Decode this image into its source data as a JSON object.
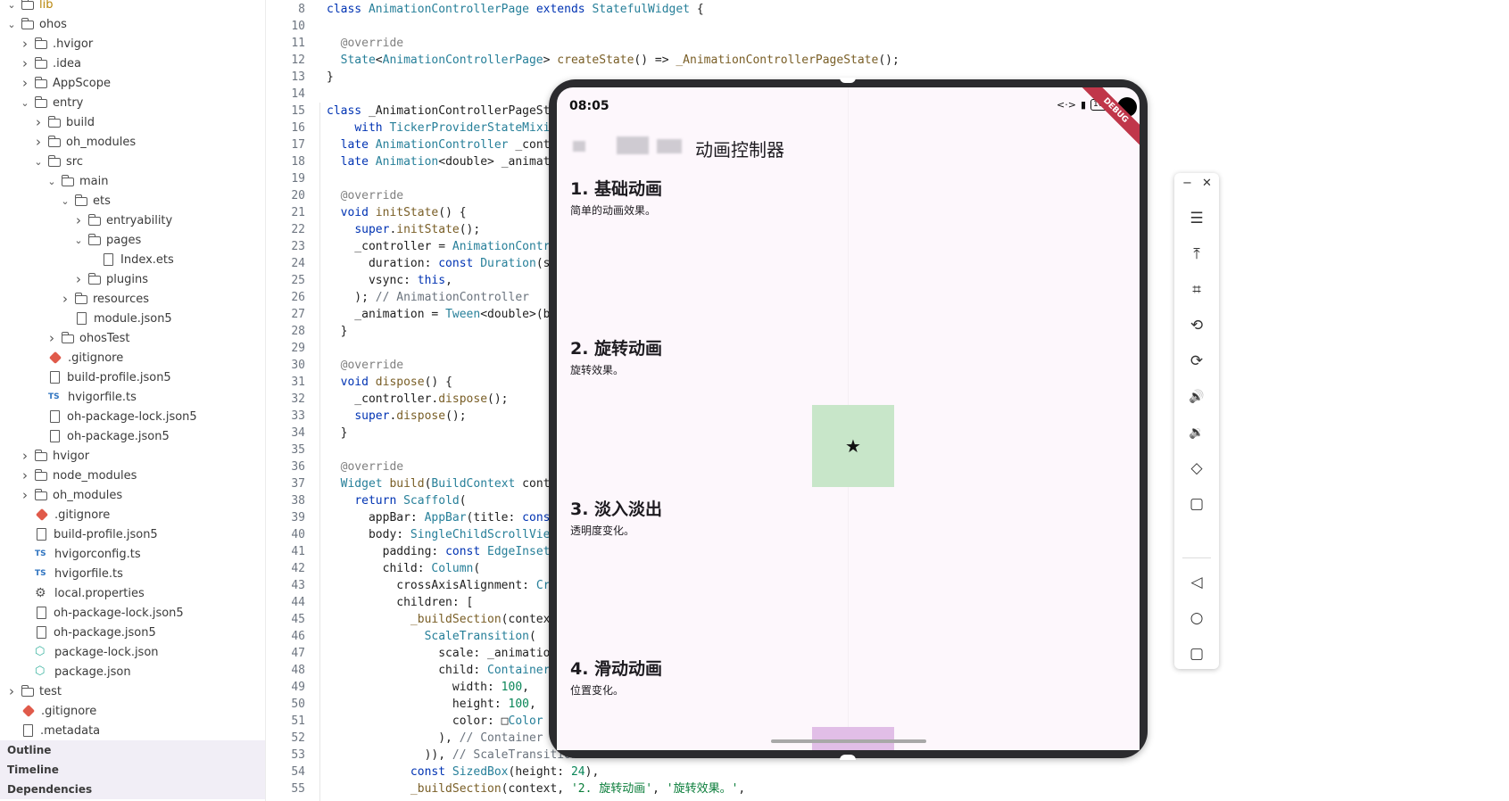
{
  "explorer": {
    "items": [
      {
        "label": "lib",
        "depth": 0,
        "kind": "folder",
        "chev": "expanded"
      },
      {
        "label": "ohos",
        "depth": 0,
        "kind": "folder",
        "chev": "expanded"
      },
      {
        "label": ".hvigor",
        "depth": 1,
        "kind": "folder",
        "chev": "collapsed"
      },
      {
        "label": ".idea",
        "depth": 1,
        "kind": "folder",
        "chev": "collapsed"
      },
      {
        "label": "AppScope",
        "depth": 1,
        "kind": "folder",
        "chev": "collapsed"
      },
      {
        "label": "entry",
        "depth": 1,
        "kind": "folder",
        "chev": "expanded"
      },
      {
        "label": "build",
        "depth": 2,
        "kind": "folder",
        "chev": "collapsed"
      },
      {
        "label": "oh_modules",
        "depth": 2,
        "kind": "folder",
        "chev": "collapsed"
      },
      {
        "label": "src",
        "depth": 2,
        "kind": "folder",
        "chev": "expanded"
      },
      {
        "label": "main",
        "depth": 3,
        "kind": "folder",
        "chev": "expanded"
      },
      {
        "label": "ets",
        "depth": 4,
        "kind": "folder",
        "chev": "expanded"
      },
      {
        "label": "entryability",
        "depth": 5,
        "kind": "folder",
        "chev": "collapsed"
      },
      {
        "label": "pages",
        "depth": 5,
        "kind": "folder",
        "chev": "expanded"
      },
      {
        "label": "Index.ets",
        "depth": 6,
        "kind": "file",
        "chev": "none"
      },
      {
        "label": "plugins",
        "depth": 5,
        "kind": "folder",
        "chev": "collapsed"
      },
      {
        "label": "resources",
        "depth": 4,
        "kind": "folder",
        "chev": "collapsed"
      },
      {
        "label": "module.json5",
        "depth": 4,
        "kind": "file",
        "chev": "none"
      },
      {
        "label": "ohosTest",
        "depth": 3,
        "kind": "folder",
        "chev": "collapsed"
      },
      {
        "label": ".gitignore",
        "depth": 2,
        "kind": "git",
        "chev": "none"
      },
      {
        "label": "build-profile.json5",
        "depth": 2,
        "kind": "file",
        "chev": "none"
      },
      {
        "label": "hvigorfile.ts",
        "depth": 2,
        "kind": "ts",
        "chev": "none"
      },
      {
        "label": "oh-package-lock.json5",
        "depth": 2,
        "kind": "file",
        "chev": "none"
      },
      {
        "label": "oh-package.json5",
        "depth": 2,
        "kind": "file",
        "chev": "none"
      },
      {
        "label": "hvigor",
        "depth": 1,
        "kind": "folder",
        "chev": "collapsed"
      },
      {
        "label": "node_modules",
        "depth": 1,
        "kind": "folder",
        "chev": "collapsed"
      },
      {
        "label": "oh_modules",
        "depth": 1,
        "kind": "folder",
        "chev": "collapsed"
      },
      {
        "label": ".gitignore",
        "depth": 1,
        "kind": "git",
        "chev": "none"
      },
      {
        "label": "build-profile.json5",
        "depth": 1,
        "kind": "file",
        "chev": "none"
      },
      {
        "label": "hvigorconfig.ts",
        "depth": 1,
        "kind": "ts",
        "chev": "none"
      },
      {
        "label": "hvigorfile.ts",
        "depth": 1,
        "kind": "ts",
        "chev": "none"
      },
      {
        "label": "local.properties",
        "depth": 1,
        "kind": "gear",
        "chev": "none"
      },
      {
        "label": "oh-package-lock.json5",
        "depth": 1,
        "kind": "file",
        "chev": "none"
      },
      {
        "label": "oh-package.json5",
        "depth": 1,
        "kind": "file",
        "chev": "none"
      },
      {
        "label": "package-lock.json",
        "depth": 1,
        "kind": "pkg",
        "chev": "none"
      },
      {
        "label": "package.json",
        "depth": 1,
        "kind": "pkg",
        "chev": "none"
      },
      {
        "label": "test",
        "depth": 0,
        "kind": "folder",
        "chev": "collapsed"
      },
      {
        "label": ".gitignore",
        "depth": 0,
        "kind": "git",
        "chev": "none"
      },
      {
        "label": ".metadata",
        "depth": 0,
        "kind": "file",
        "chev": "none"
      }
    ],
    "panels": [
      "Outline",
      "Timeline",
      "Dependencies"
    ]
  },
  "editor": {
    "lines": [
      {
        "n": "8",
        "t": "class AnimationControllerPage extends StatefulWidget {"
      },
      {
        "n": "10",
        "t": ""
      },
      {
        "n": "11",
        "t": "  @override"
      },
      {
        "n": "12",
        "t": "  State<AnimationControllerPage> createState() => _AnimationControllerPageState();"
      },
      {
        "n": "13",
        "t": "}"
      },
      {
        "n": "14",
        "t": ""
      },
      {
        "n": "15",
        "t": "class _AnimationControllerPageSt"
      },
      {
        "n": "16",
        "t": "    with TickerProviderStateMixi"
      },
      {
        "n": "17",
        "t": "  late AnimationController _cont"
      },
      {
        "n": "18",
        "t": "  late Animation<double> _animat"
      },
      {
        "n": "19",
        "t": ""
      },
      {
        "n": "20",
        "t": "  @override"
      },
      {
        "n": "21",
        "t": "  void initState() {"
      },
      {
        "n": "22",
        "t": "    super.initState();"
      },
      {
        "n": "23",
        "t": "    _controller = AnimationContro"
      },
      {
        "n": "24",
        "t": "      duration: const Duration(se"
      },
      {
        "n": "25",
        "t": "      vsync: this,"
      },
      {
        "n": "26",
        "t": "    ); // AnimationController"
      },
      {
        "n": "27",
        "t": "    _animation = Tween<double>(be"
      },
      {
        "n": "28",
        "t": "  }"
      },
      {
        "n": "29",
        "t": ""
      },
      {
        "n": "30",
        "t": "  @override"
      },
      {
        "n": "31",
        "t": "  void dispose() {"
      },
      {
        "n": "32",
        "t": "    _controller.dispose();"
      },
      {
        "n": "33",
        "t": "    super.dispose();"
      },
      {
        "n": "34",
        "t": "  }"
      },
      {
        "n": "35",
        "t": ""
      },
      {
        "n": "36",
        "t": "  @override"
      },
      {
        "n": "37",
        "t": "  Widget build(BuildContext conte"
      },
      {
        "n": "38",
        "t": "    return Scaffold("
      },
      {
        "n": "39",
        "t": "      appBar: AppBar(title: const"
      },
      {
        "n": "40",
        "t": "      body: SingleChildScrollVie"
      },
      {
        "n": "41",
        "t": "        padding: const EdgeInset"
      },
      {
        "n": "42",
        "t": "        child: Column("
      },
      {
        "n": "43",
        "t": "          crossAxisAlignment: Cr"
      },
      {
        "n": "44",
        "t": "          children: ["
      },
      {
        "n": "45",
        "t": "            _buildSection(contex"
      },
      {
        "n": "46",
        "t": "              ScaleTransition("
      },
      {
        "n": "47",
        "t": "                scale: _animatio"
      },
      {
        "n": "48",
        "t": "                child: Container"
      },
      {
        "n": "49",
        "t": "                  width: 100,"
      },
      {
        "n": "50",
        "t": "                  height: 100,"
      },
      {
        "n": "51",
        "t": "                  color: □Color"
      },
      {
        "n": "52",
        "t": "                ), // Container"
      },
      {
        "n": "53",
        "t": "              )), // ScaleTransition"
      },
      {
        "n": "54",
        "t": "            const SizedBox(height: 24),"
      },
      {
        "n": "55",
        "t": "            _buildSection(context, '2. 旋转动画', '旋转效果。',"
      }
    ]
  },
  "device": {
    "time": "08:05",
    "battery": "100",
    "debug_label": "DEBUG",
    "app_title": "动画控制器",
    "sections": [
      {
        "title": "1. 基础动画",
        "desc": "简单的动画效果。"
      },
      {
        "title": "2. 旋转动画",
        "desc": "旋转效果。"
      },
      {
        "title": "3. 淡入淡出",
        "desc": "透明度变化。"
      },
      {
        "title": "4. 滑动动画",
        "desc": "位置变化。"
      }
    ],
    "box_icon": "★",
    "colors": {
      "green_box": "#c8e6c9",
      "purple_box": "#e1bee7",
      "screen_bg": "#fdf7fc"
    }
  },
  "toolbar": {
    "minimize": "−",
    "close": "✕",
    "buttons": [
      {
        "name": "menu-icon",
        "glyph": "☰"
      },
      {
        "name": "pin-top-icon",
        "glyph": "⤒"
      },
      {
        "name": "crop-icon",
        "glyph": "⌗"
      },
      {
        "name": "rotate-icon",
        "glyph": "⟲"
      },
      {
        "name": "rotate-alt-icon",
        "glyph": "⟳"
      },
      {
        "name": "volume-up-icon",
        "glyph": "🔊"
      },
      {
        "name": "volume-down-icon",
        "glyph": "🔉"
      },
      {
        "name": "fold-icon",
        "glyph": "◇"
      },
      {
        "name": "screen-icon",
        "glyph": "▢"
      },
      {
        "name": "back-icon",
        "glyph": "◁"
      },
      {
        "name": "home-icon",
        "glyph": "○"
      },
      {
        "name": "recents-icon",
        "glyph": "▢"
      }
    ]
  }
}
